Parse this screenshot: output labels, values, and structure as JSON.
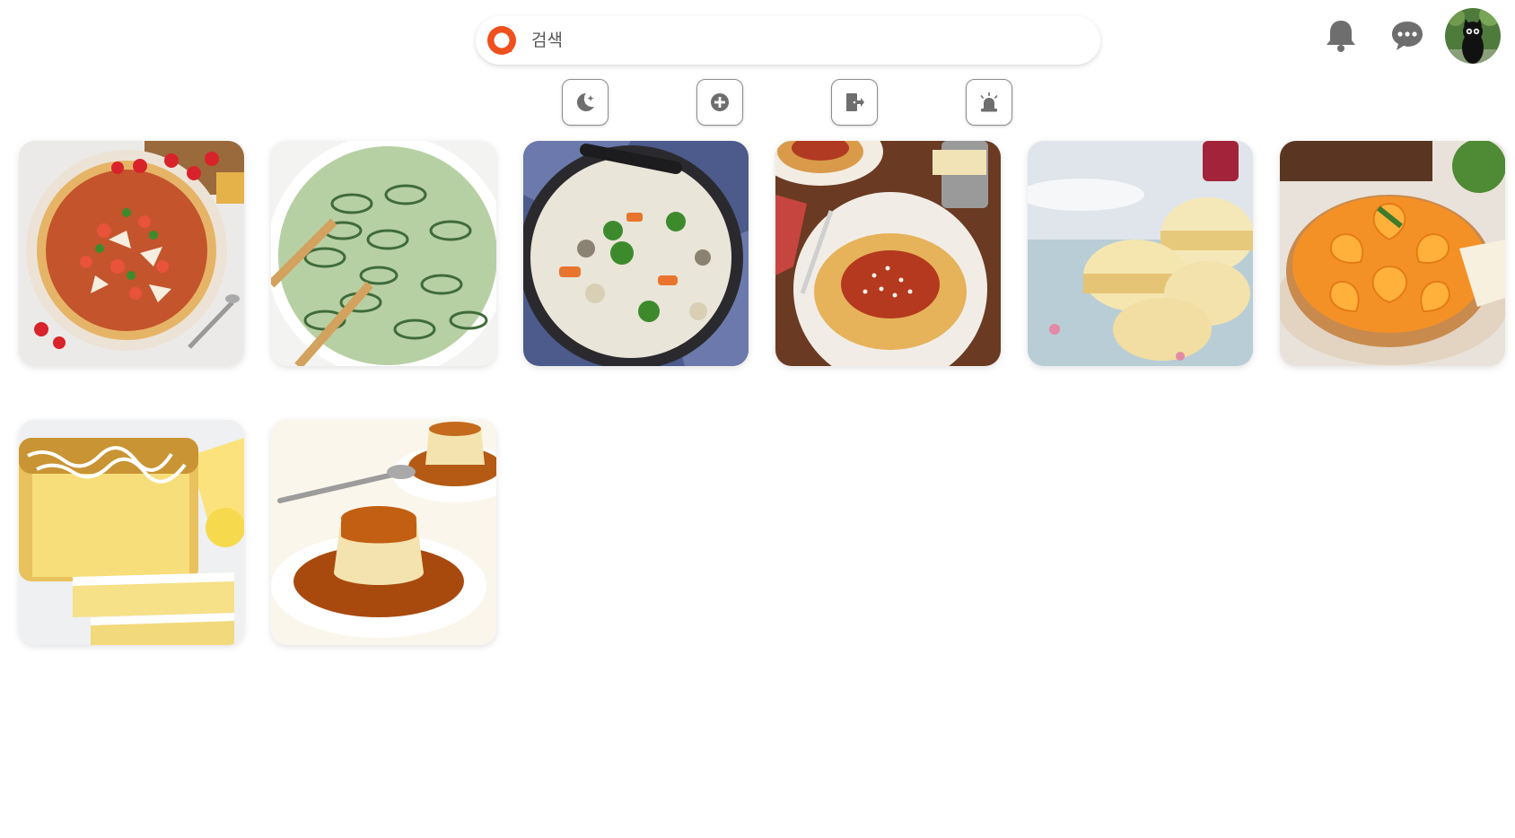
{
  "search": {
    "placeholder": "검색"
  },
  "header": {
    "icons": [
      "bell-icon",
      "chat-icon"
    ],
    "avatar": "user-avatar"
  },
  "toolbar": {
    "buttons": [
      "dark-mode-icon",
      "add-circle-icon",
      "logout-icon",
      "siren-icon"
    ]
  },
  "cards": [
    {
      "name": "pizza"
    },
    {
      "name": "cucumber-salad"
    },
    {
      "name": "cream-soup"
    },
    {
      "name": "spaghetti-bolognese"
    },
    {
      "name": "biscuits"
    },
    {
      "name": "orange-tart"
    },
    {
      "name": "lemon-pound-cake"
    },
    {
      "name": "caramel-pudding"
    }
  ],
  "colors": {
    "brand": "#f0501e",
    "icon_gray": "#6e6e6e",
    "tool_border": "#8c8c8c"
  }
}
